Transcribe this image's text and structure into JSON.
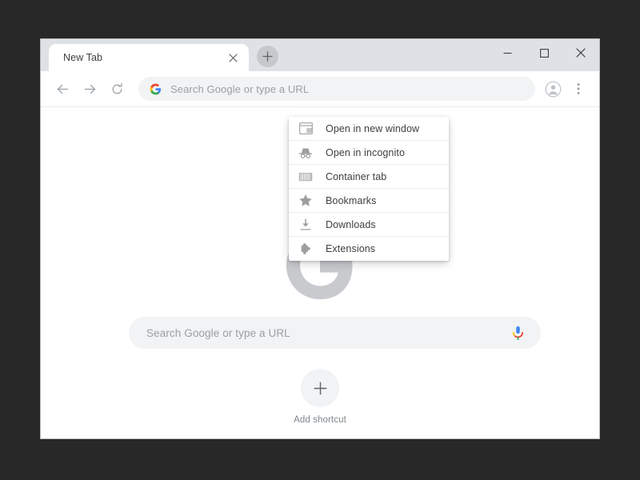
{
  "window": {
    "controls": {
      "minimize_label": "—",
      "maximize_label": "□",
      "close_label": "×",
      "minimize_icon": "minimize-icon",
      "maximize_icon": "maximize-icon",
      "close_icon": "close-icon"
    }
  },
  "tab_strip": {
    "tabs": [
      {
        "title": "New Tab",
        "close_icon": "close-icon",
        "active": true
      }
    ],
    "new_tab_button": {
      "icon": "plus-icon",
      "hovered": true
    }
  },
  "toolbar": {
    "back_icon": "back-arrow-icon",
    "forward_icon": "forward-arrow-icon",
    "reload_icon": "reload-icon",
    "omnibox": {
      "leading_icon": "google-g-icon",
      "placeholder": "Search Google or type a URL",
      "value": ""
    },
    "profile_icon": "profile-avatar-icon",
    "menu_icon": "three-dot-menu-icon"
  },
  "newtab": {
    "logo_icon": "google-logo",
    "search_box": {
      "placeholder": "Search Google or type a URL",
      "value": "",
      "voice_icon": "microphone-icon"
    },
    "add_shortcut": {
      "icon": "plus-icon",
      "label": "Add shortcut"
    }
  },
  "context_menu": {
    "items": [
      {
        "label": "Open in new window",
        "icon": "new-window-icon"
      },
      {
        "label": "Open in incognito",
        "icon": "incognito-icon"
      },
      {
        "label": "Container tab",
        "icon": "container-tab-icon"
      },
      {
        "label": "Bookmarks",
        "icon": "star-icon"
      },
      {
        "label": "Downloads",
        "icon": "download-icon"
      },
      {
        "label": "Extensions",
        "icon": "puzzle-piece-icon"
      }
    ]
  },
  "colors": {
    "desktop_background": "#282828",
    "tab_strip_background": "#dee1e6",
    "omnibox_background": "#f1f3f4",
    "text_primary": "#3c4043",
    "text_muted": "#9aa0a6",
    "google_blue": "#4285f4",
    "google_red": "#ea4335",
    "google_yellow": "#fbbc05",
    "google_green": "#34a853"
  }
}
